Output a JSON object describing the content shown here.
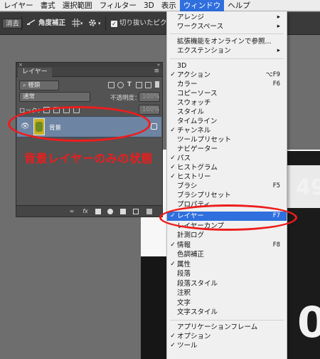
{
  "menubar": {
    "items": [
      "レイヤー",
      "書式",
      "選択範囲",
      "フィルター",
      "3D",
      "表示",
      "ウィンドウ",
      "ヘルプ"
    ],
    "active_index": 6
  },
  "options_bar": {
    "erase_button": "消去",
    "straighten_label": "角度補正",
    "checkbox_label": "切り抜いたピクセルを"
  },
  "layers_panel": {
    "tab_label": "レイヤー",
    "filter_select": "種類",
    "blend_mode": "通常",
    "opacity_label": "不透明度：",
    "opacity_value": "100%",
    "lock_label": "ロック：",
    "fill_value": "100%",
    "layer_name": "背景"
  },
  "annotation": {
    "caption": "背景レイヤーのみの状態",
    "color": "#ef1c1c"
  },
  "window_menu": {
    "items": [
      {
        "label": "アレンジ",
        "submenu": "▸"
      },
      {
        "label": "ワークスペース",
        "submenu": "▸"
      },
      {
        "label": "拡張機能をオンラインで参照..."
      },
      {
        "label": "エクステンション",
        "submenu": "▸"
      },
      {
        "label": "3D"
      },
      {
        "label": "アクション",
        "checked": "✓",
        "shortcut": "⌥F9"
      },
      {
        "label": "カラー",
        "shortcut": "F6"
      },
      {
        "label": "コピーソース"
      },
      {
        "label": "スウォッチ"
      },
      {
        "label": "スタイル"
      },
      {
        "label": "タイムライン"
      },
      {
        "label": "チャンネル",
        "checked": "✓"
      },
      {
        "label": "ツールプリセット"
      },
      {
        "label": "ナビゲーター"
      },
      {
        "label": "パス",
        "checked": "✓"
      },
      {
        "label": "ヒストグラム",
        "checked": "✓"
      },
      {
        "label": "ヒストリー",
        "checked": "✓"
      },
      {
        "label": "ブラシ",
        "shortcut": "F5"
      },
      {
        "label": "ブラシプリセット"
      },
      {
        "label": "プロパティ"
      },
      {
        "label": "レイヤー",
        "checked": "✓",
        "shortcut": "F7"
      },
      {
        "label": "レイヤーカンプ"
      },
      {
        "label": "計測ログ"
      },
      {
        "label": "情報",
        "checked": "✓",
        "shortcut": "F8"
      },
      {
        "label": "色調補正"
      },
      {
        "label": "属性",
        "checked": "✓"
      },
      {
        "label": "段落"
      },
      {
        "label": "段落スタイル"
      },
      {
        "label": "注釈"
      },
      {
        "label": "文字"
      },
      {
        "label": "文字スタイル"
      },
      {
        "label": "アプリケーションフレーム"
      },
      {
        "label": "オプション",
        "checked": "✓"
      },
      {
        "label": "ツール",
        "checked": "✓"
      }
    ]
  },
  "canvas": {
    "digit_top": "49",
    "digit_bottom": "0"
  },
  "icons": [
    "eye-icon",
    "lock-icon",
    "link-icon",
    "fx-icon",
    "mask-icon",
    "adjustment-icon",
    "folder-icon",
    "new-layer-icon",
    "trash-icon",
    "grid-icon",
    "gear-icon"
  ]
}
